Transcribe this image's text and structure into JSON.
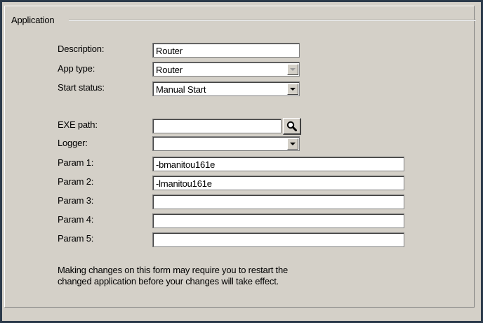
{
  "group": {
    "title": "Application"
  },
  "fields": {
    "description": {
      "label": "Description:",
      "value": "Router"
    },
    "app_type": {
      "label": "App type:",
      "value": "Router"
    },
    "start_status": {
      "label": "Start status:",
      "value": "Manual Start"
    },
    "exe_path": {
      "label": "EXE path:",
      "value": ""
    },
    "logger": {
      "label": "Logger:",
      "value": ""
    },
    "param1": {
      "label": "Param 1:",
      "value": "-bmanitou161e"
    },
    "param2": {
      "label": "Param 2:",
      "value": "-lmanitou161e"
    },
    "param3": {
      "label": "Param 3:",
      "value": ""
    },
    "param4": {
      "label": "Param 4:",
      "value": ""
    },
    "param5": {
      "label": "Param 5:",
      "value": ""
    }
  },
  "note": {
    "line1": "Making changes on this form may require you to restart the",
    "line2": "changed application before your changes will take effect."
  },
  "icons": {
    "browse": "search-icon"
  },
  "colors": {
    "background": "#d4d0c8",
    "border": "#2b3a4a"
  }
}
